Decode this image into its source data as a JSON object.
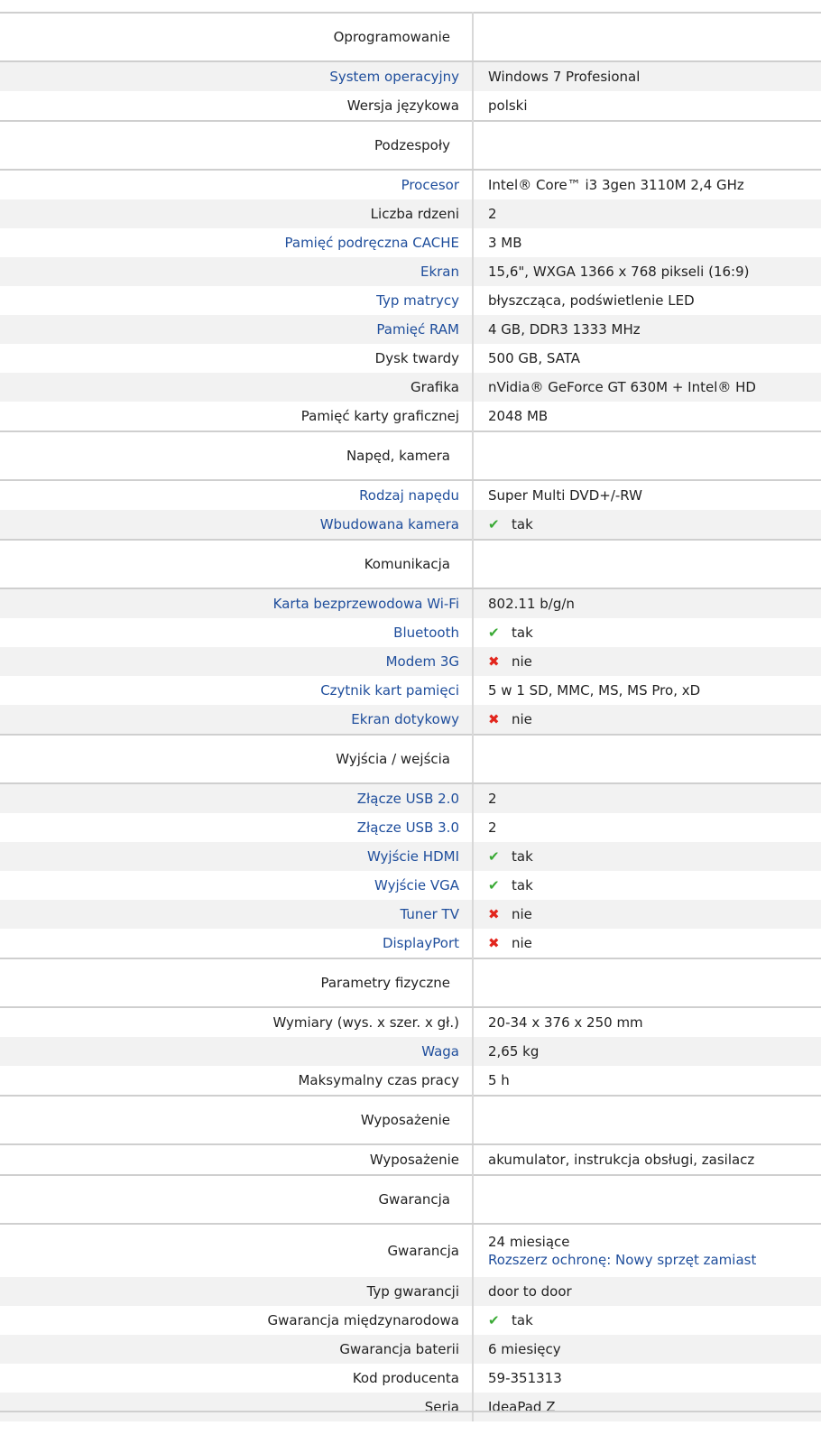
{
  "colors": {
    "link": "#1f4e9c",
    "check": "#3aaa35",
    "cross": "#e2261d",
    "stripe": "#f2f2f2",
    "divider": "#d8d8d8"
  },
  "rows": [
    {
      "type": "section",
      "label": "Oprogramowanie"
    },
    {
      "type": "row",
      "label": "System operacyjny",
      "link": true,
      "value": "Windows 7 Profesional"
    },
    {
      "type": "row",
      "label": "Wersja językowa",
      "link": false,
      "value": "polski"
    },
    {
      "type": "section",
      "label": "Podzespoły"
    },
    {
      "type": "row",
      "label": "Procesor",
      "link": true,
      "value": "Intel® Core™ i3 3gen 3110M 2,4 GHz"
    },
    {
      "type": "row",
      "label": "Liczba rdzeni",
      "link": false,
      "value": "2"
    },
    {
      "type": "row",
      "label": "Pamięć podręczna CACHE",
      "link": true,
      "value": "3 MB"
    },
    {
      "type": "row",
      "label": "Ekran",
      "link": true,
      "value": "15,6\", WXGA 1366 x 768 pikseli (16:9)"
    },
    {
      "type": "row",
      "label": "Typ matrycy",
      "link": true,
      "value": "błyszcząca, podświetlenie LED"
    },
    {
      "type": "row",
      "label": "Pamięć RAM",
      "link": true,
      "value": "4 GB, DDR3 1333 MHz"
    },
    {
      "type": "row",
      "label": "Dysk twardy",
      "link": false,
      "value": "500 GB, SATA"
    },
    {
      "type": "row",
      "label": "Grafika",
      "link": false,
      "value": "nVidia® GeForce GT 630M + Intel® HD"
    },
    {
      "type": "row",
      "label": "Pamięć karty graficznej",
      "link": false,
      "value": "2048 MB"
    },
    {
      "type": "section",
      "label": "Napęd, kamera"
    },
    {
      "type": "row",
      "label": "Rodzaj napędu",
      "link": true,
      "value": "Super Multi DVD+/-RW"
    },
    {
      "type": "row",
      "label": "Wbudowana kamera",
      "link": true,
      "icon": "check",
      "value": "tak"
    },
    {
      "type": "section",
      "label": "Komunikacja"
    },
    {
      "type": "row",
      "label": "Karta bezprzewodowa Wi-Fi",
      "link": true,
      "value": "802.11 b/g/n"
    },
    {
      "type": "row",
      "label": "Bluetooth",
      "link": true,
      "icon": "check",
      "value": "tak"
    },
    {
      "type": "row",
      "label": "Modem 3G",
      "link": true,
      "icon": "cross",
      "value": "nie"
    },
    {
      "type": "row",
      "label": "Czytnik kart pamięci",
      "link": true,
      "value": "5 w 1 SD, MMC, MS, MS Pro, xD"
    },
    {
      "type": "row",
      "label": "Ekran dotykowy",
      "link": true,
      "icon": "cross",
      "value": "nie"
    },
    {
      "type": "section",
      "label": "Wyjścia / wejścia"
    },
    {
      "type": "row",
      "label": "Złącze USB 2.0",
      "link": true,
      "value": "2"
    },
    {
      "type": "row",
      "label": "Złącze USB 3.0",
      "link": true,
      "value": "2"
    },
    {
      "type": "row",
      "label": "Wyjście HDMI",
      "link": true,
      "icon": "check",
      "value": "tak"
    },
    {
      "type": "row",
      "label": "Wyjście VGA",
      "link": true,
      "icon": "check",
      "value": "tak"
    },
    {
      "type": "row",
      "label": "Tuner TV",
      "link": true,
      "icon": "cross",
      "value": "nie"
    },
    {
      "type": "row",
      "label": "DisplayPort",
      "link": true,
      "icon": "cross",
      "value": "nie"
    },
    {
      "type": "section",
      "label": "Parametry fizyczne"
    },
    {
      "type": "row",
      "label": "Wymiary (wys. x szer. x gł.)",
      "link": false,
      "value": "20-34 x 376 x 250 mm"
    },
    {
      "type": "row",
      "label": "Waga",
      "link": true,
      "value": "2,65 kg"
    },
    {
      "type": "row",
      "label": "Maksymalny czas pracy",
      "link": false,
      "value": "5 h"
    },
    {
      "type": "section",
      "label": "Wyposażenie"
    },
    {
      "type": "row",
      "label": "Wyposażenie",
      "link": false,
      "value": "akumulator, instrukcja obsługi, zasilacz"
    },
    {
      "type": "section",
      "label": "Gwarancja"
    },
    {
      "type": "row",
      "label": "Gwarancja",
      "link": false,
      "tall": true,
      "value": "24 miesiące",
      "sub": "Rozszerz ochronę: Nowy sprzęt zamiast"
    },
    {
      "type": "row",
      "label": "Typ gwarancji",
      "link": false,
      "value": "door to door"
    },
    {
      "type": "row",
      "label": "Gwarancja międzynarodowa",
      "link": false,
      "icon": "check",
      "value": "tak"
    },
    {
      "type": "row",
      "label": "Gwarancja baterii",
      "link": false,
      "value": "6 miesięcy"
    },
    {
      "type": "row",
      "label": "Kod producenta",
      "link": false,
      "value": "59-351313"
    },
    {
      "type": "row",
      "label": "Seria",
      "link": false,
      "value": "IdeaPad Z"
    }
  ]
}
